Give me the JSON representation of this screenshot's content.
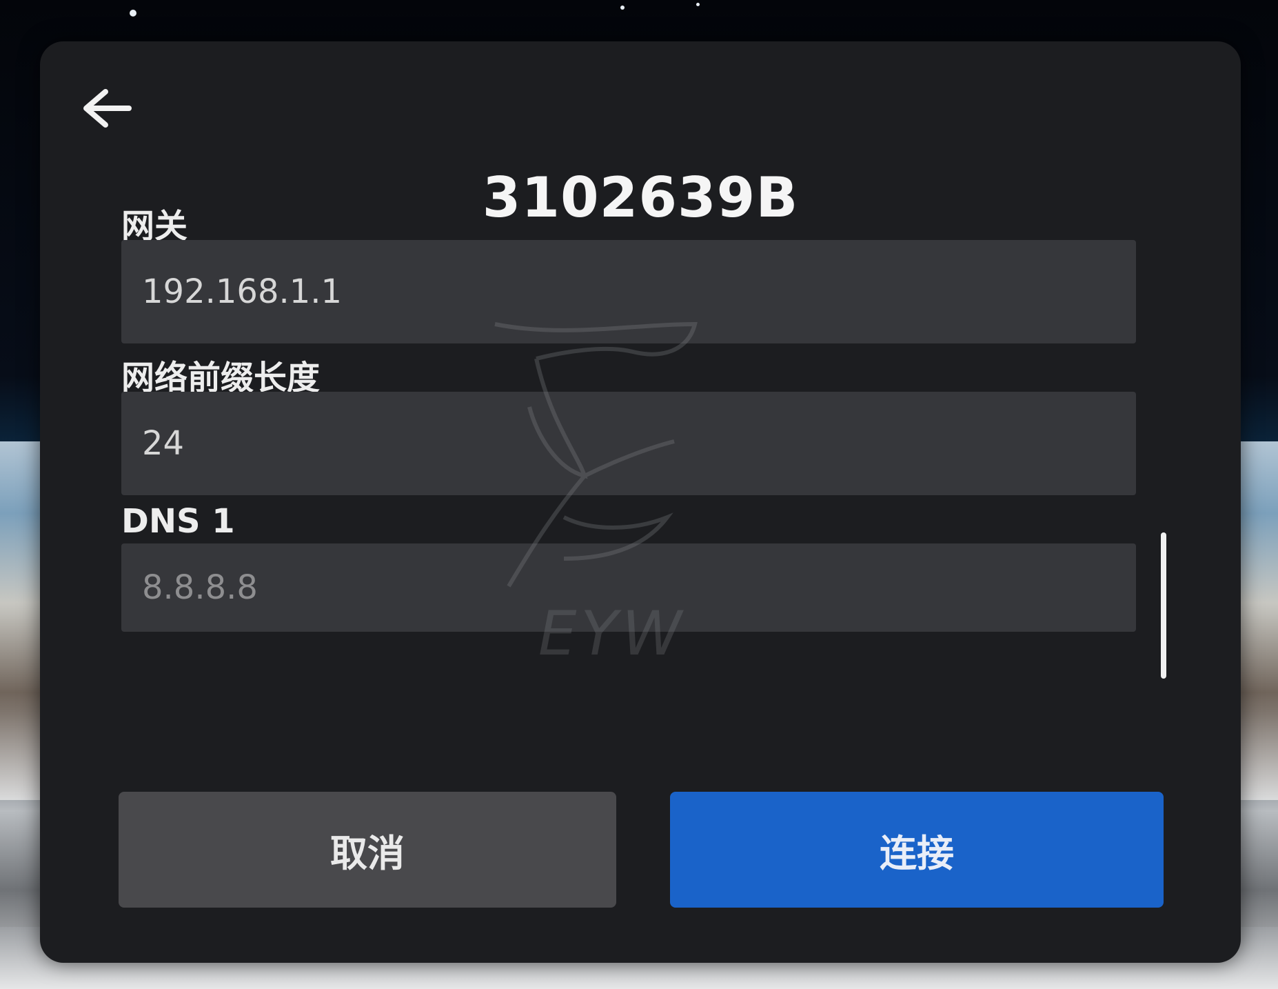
{
  "dialog": {
    "title": "3102639B",
    "back_icon": "arrow-left-icon"
  },
  "fields": [
    {
      "label": "网关",
      "value": "192.168.1.1"
    },
    {
      "label": "网络前缀长度",
      "value": "24"
    },
    {
      "label": "DNS 1",
      "placeholder": "8.8.8.8"
    }
  ],
  "buttons": {
    "cancel_label": "取消",
    "connect_label": "连接"
  },
  "watermark": {
    "text": "EYW"
  },
  "colors": {
    "panel": "#1c1d20",
    "field": "#36373b",
    "cancel": "#49494c",
    "accent": "#1a63c9"
  }
}
